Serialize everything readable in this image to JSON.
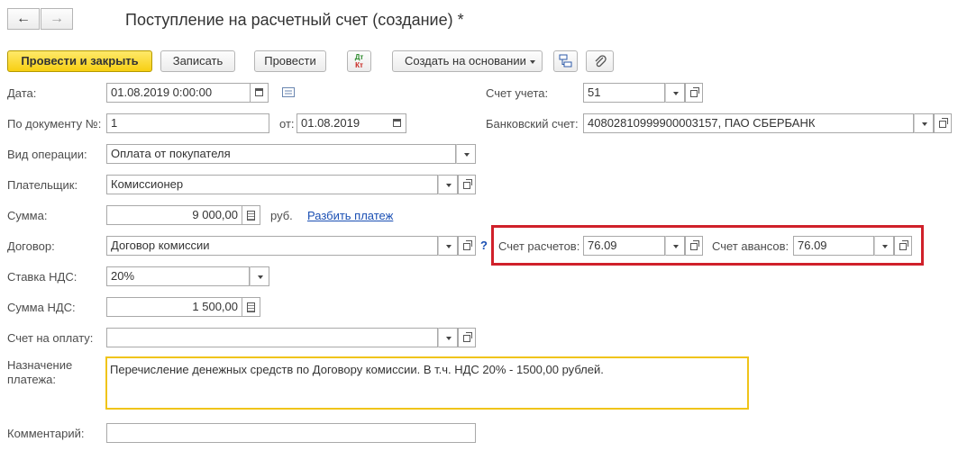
{
  "window": {
    "title": "Поступление на расчетный счет (создание) *",
    "back_icon": "←",
    "forward_icon": "→"
  },
  "toolbar": {
    "post_and_close": "Провести и закрыть",
    "save": "Записать",
    "post": "Провести",
    "dt_kt_top": "Дт",
    "dt_kt_bottom": "Кт",
    "create_based_on": "Создать на основании"
  },
  "form": {
    "date": {
      "label": "Дата:",
      "value": "01.08.2019  0:00:00"
    },
    "doc_number": {
      "label": "По документу №:",
      "value": "1",
      "from_label": "от:",
      "from_value": "01.08.2019"
    },
    "operation_type": {
      "label": "Вид операции:",
      "value": "Оплата от покупателя"
    },
    "payer": {
      "label": "Плательщик:",
      "value": "Комиссионер"
    },
    "amount": {
      "label": "Сумма:",
      "value": "9 000,00",
      "currency": "руб.",
      "split_link": "Разбить платеж"
    },
    "contract": {
      "label": "Договор:",
      "value": "Договор комиссии",
      "help": "?"
    },
    "vat_rate": {
      "label": "Ставка НДС:",
      "value": "20%"
    },
    "vat_amount": {
      "label": "Сумма НДС:",
      "value": "1 500,00"
    },
    "invoice": {
      "label": "Счет на оплату:",
      "value": ""
    },
    "purpose": {
      "label_line1": "Назначение",
      "label_line2": "платежа:",
      "value": "Перечисление денежных средств по Договору комиссии. В т.ч. НДС 20% - 1500,00 рублей."
    },
    "comment": {
      "label": "Комментарий:",
      "value": ""
    },
    "account": {
      "label": "Счет учета:",
      "value": "51"
    },
    "bank_account": {
      "label": "Банковский счет:",
      "value": "40802810999900003157, ПАО СБЕРБАНК"
    },
    "settlement_account": {
      "label": "Счет расчетов:",
      "value": "76.09"
    },
    "advance_account": {
      "label": "Счет авансов:",
      "value": "76.09"
    }
  },
  "colors": {
    "highlight_border": "#d0202a",
    "purpose_border": "#f0c419",
    "primary_button": "#f7cf12",
    "link": "#1a4fb3"
  }
}
